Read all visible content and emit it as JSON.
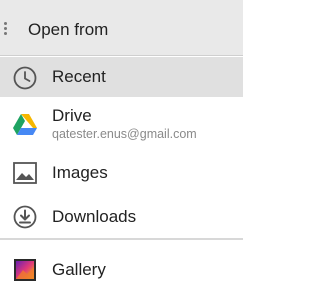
{
  "header": {
    "title": "Open from"
  },
  "items": {
    "recent": {
      "label": "Recent",
      "icon": "clock-icon"
    },
    "drive": {
      "label": "Drive",
      "sublabel": "qatester.enus@gmail.com",
      "icon": "google-drive-icon"
    },
    "images": {
      "label": "Images",
      "icon": "image-icon"
    },
    "downloads": {
      "label": "Downloads",
      "icon": "download-icon"
    },
    "gallery": {
      "label": "Gallery",
      "icon": "gallery-app-icon"
    }
  },
  "colors": {
    "header_bg": "#e9e9e9",
    "selected_bg": "#e0e0e0",
    "text": "#222222",
    "subtext": "#8a8a8a"
  }
}
